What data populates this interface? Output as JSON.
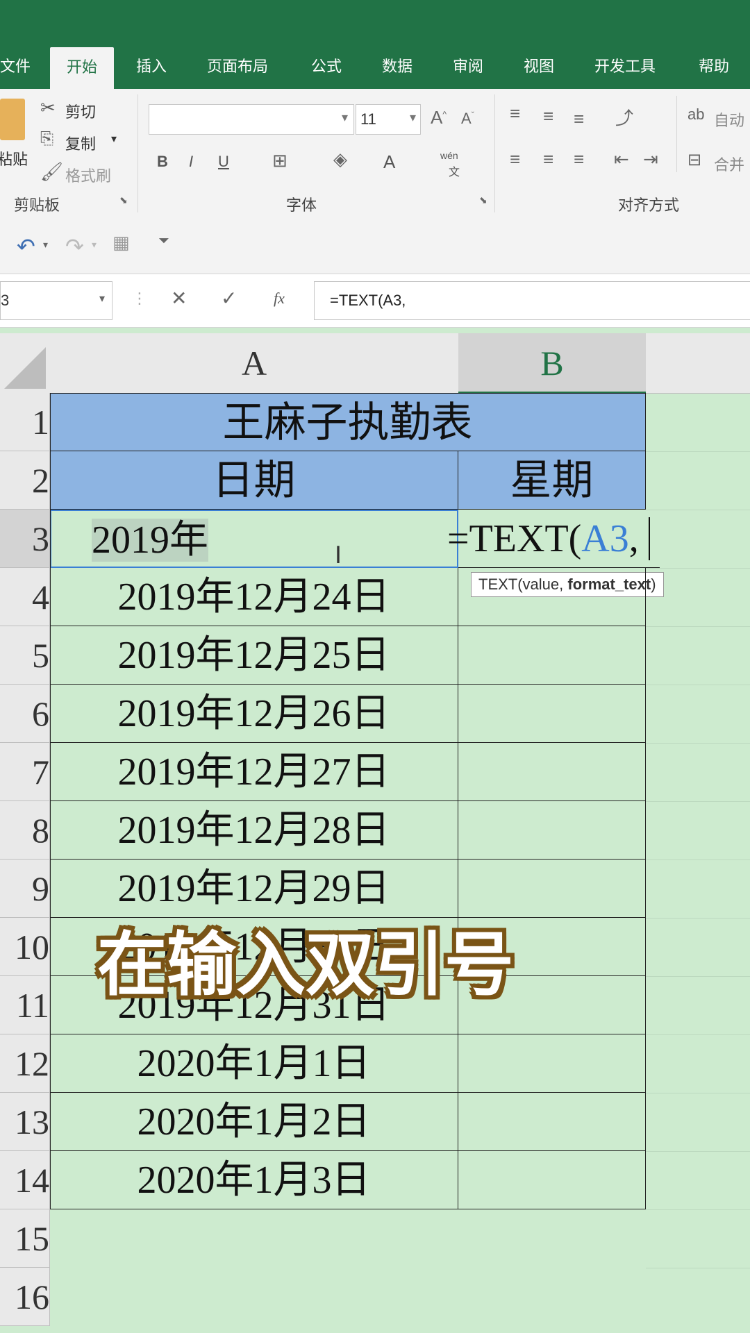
{
  "tabs": [
    "文件",
    "开始",
    "插入",
    "页面布局",
    "公式",
    "数据",
    "审阅",
    "视图",
    "开发工具",
    "帮助"
  ],
  "ribbon": {
    "clipboard": {
      "paste": "粘贴",
      "cut": "剪切",
      "copy": "复制",
      "format_painter": "格式刷",
      "label": "剪贴板"
    },
    "font": {
      "size": "11",
      "label": "字体",
      "bold": "B",
      "italic": "I",
      "underline": "U",
      "font_color": "A",
      "wen": "wén",
      "wen2": "文"
    },
    "align": {
      "label": "对齐方式",
      "wrap": "自动",
      "merge": "合并"
    }
  },
  "formula_bar": {
    "name_box": "3",
    "fx": "fx",
    "formula": "=TEXT(A3,"
  },
  "columns": [
    "A",
    "B"
  ],
  "rows": [
    "1",
    "2",
    "3",
    "4",
    "5",
    "6",
    "7",
    "8",
    "9",
    "10",
    "11",
    "12",
    "13",
    "14",
    "15",
    "16"
  ],
  "table": {
    "title": "王麻子执勤表",
    "header_a": "日期",
    "header_b": "星期",
    "a3": "2019年",
    "b3_prefix": "=TEXT(",
    "b3_ref": "A3",
    "b3_suffix": ",",
    "dates": [
      "2019年12月24日",
      "2019年12月25日",
      "2019年12月26日",
      "2019年12月27日",
      "2019年12月28日",
      "2019年12月29日",
      "2019年12月30日",
      "2019年12月31日",
      "2020年1月1日",
      "2020年1月2日",
      "2020年1月3日"
    ]
  },
  "tooltip": {
    "plain": "TEXT(value, ",
    "bold": "format_text",
    "end": ")"
  },
  "caption": "在输入双引号",
  "colors": {
    "accent": "#217346",
    "header_fill": "#8db4e2",
    "sheet_bg": "#cdebcf",
    "ref_blue": "#3a7fd5"
  }
}
